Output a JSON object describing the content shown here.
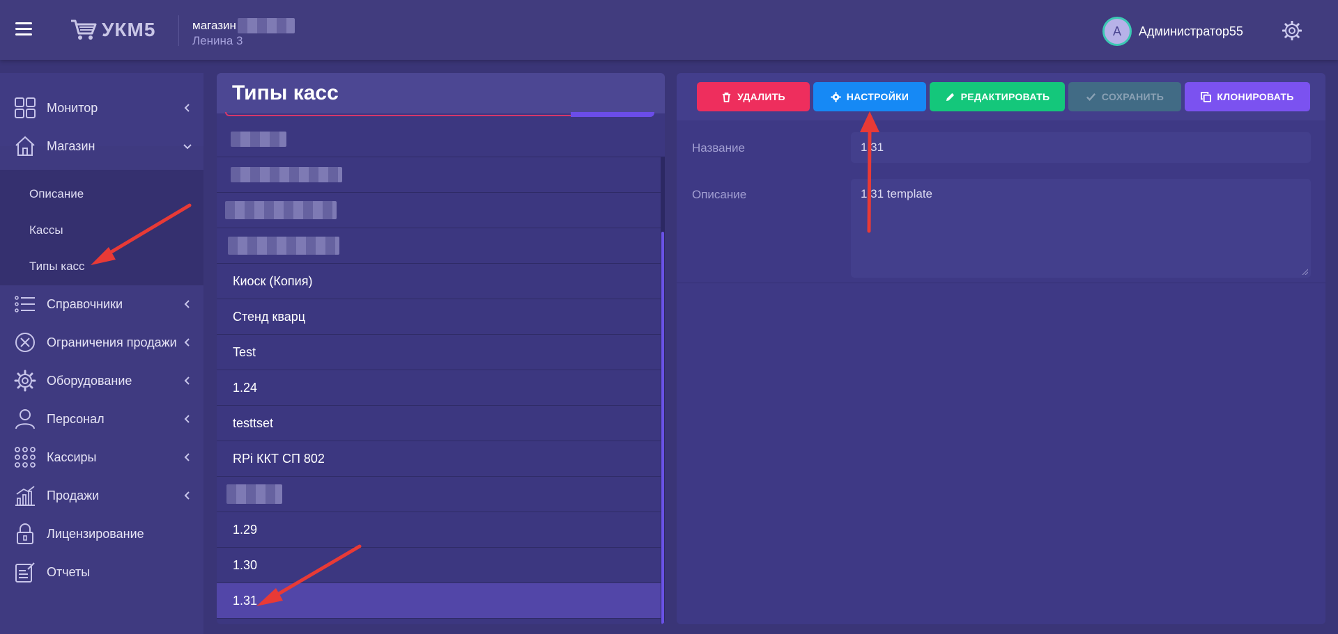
{
  "header": {
    "app_name": "УКМ5",
    "store_name": "магазин",
    "store_address": "Ленина 3",
    "user_initial": "A",
    "user_name": "Администратор55"
  },
  "sidebar": {
    "items": [
      {
        "label": "Монитор",
        "icon": "grid-icon"
      },
      {
        "label": "Магазин",
        "icon": "home-icon",
        "expanded": true
      },
      {
        "label": "Справочники",
        "icon": "list-icon"
      },
      {
        "label": "Ограничения продажи",
        "icon": "cancel-circle-icon"
      },
      {
        "label": "Оборудование",
        "icon": "gear-icon"
      },
      {
        "label": "Персонал",
        "icon": "person-icon"
      },
      {
        "label": "Кассиры",
        "icon": "dots-grid-icon"
      },
      {
        "label": "Продажи",
        "icon": "chart-icon"
      },
      {
        "label": "Лицензирование",
        "icon": "lock-icon"
      },
      {
        "label": "Отчеты",
        "icon": "report-icon"
      }
    ],
    "submenu": [
      {
        "label": "Описание"
      },
      {
        "label": "Кассы"
      },
      {
        "label": "Типы касс"
      }
    ]
  },
  "list_panel": {
    "title": "Типы касс",
    "rows": [
      {
        "label": ""
      },
      {
        "label": ""
      },
      {
        "label": ""
      },
      {
        "label": ""
      },
      {
        "label": "Киоск (Копия)"
      },
      {
        "label": "Стенд кварц"
      },
      {
        "label": "Test"
      },
      {
        "label": "1.24"
      },
      {
        "label": "testtset"
      },
      {
        "label": "RPi ККТ СП 802"
      },
      {
        "label": ""
      },
      {
        "label": "1.29"
      },
      {
        "label": "1.30"
      },
      {
        "label": "1.31",
        "selected": true
      }
    ]
  },
  "detail_panel": {
    "buttons": {
      "delete": "УДАЛИТЬ",
      "settings": "НАСТРОЙКИ",
      "edit": "РЕДАКТИРОВАТЬ",
      "save": "СОХРАНИТЬ",
      "clone": "КЛОНИРОВАТЬ"
    },
    "fields": {
      "name_label": "Название",
      "name_value": "1.31",
      "description_label": "Описание",
      "description_value": "1.31 template"
    }
  },
  "colors": {
    "delete": "#ee2e5d",
    "settings": "#1689f5",
    "edit": "#14c77b",
    "save_disabled": "#416b85",
    "clone": "#7b52f0",
    "selected_row": "#5246a8"
  }
}
